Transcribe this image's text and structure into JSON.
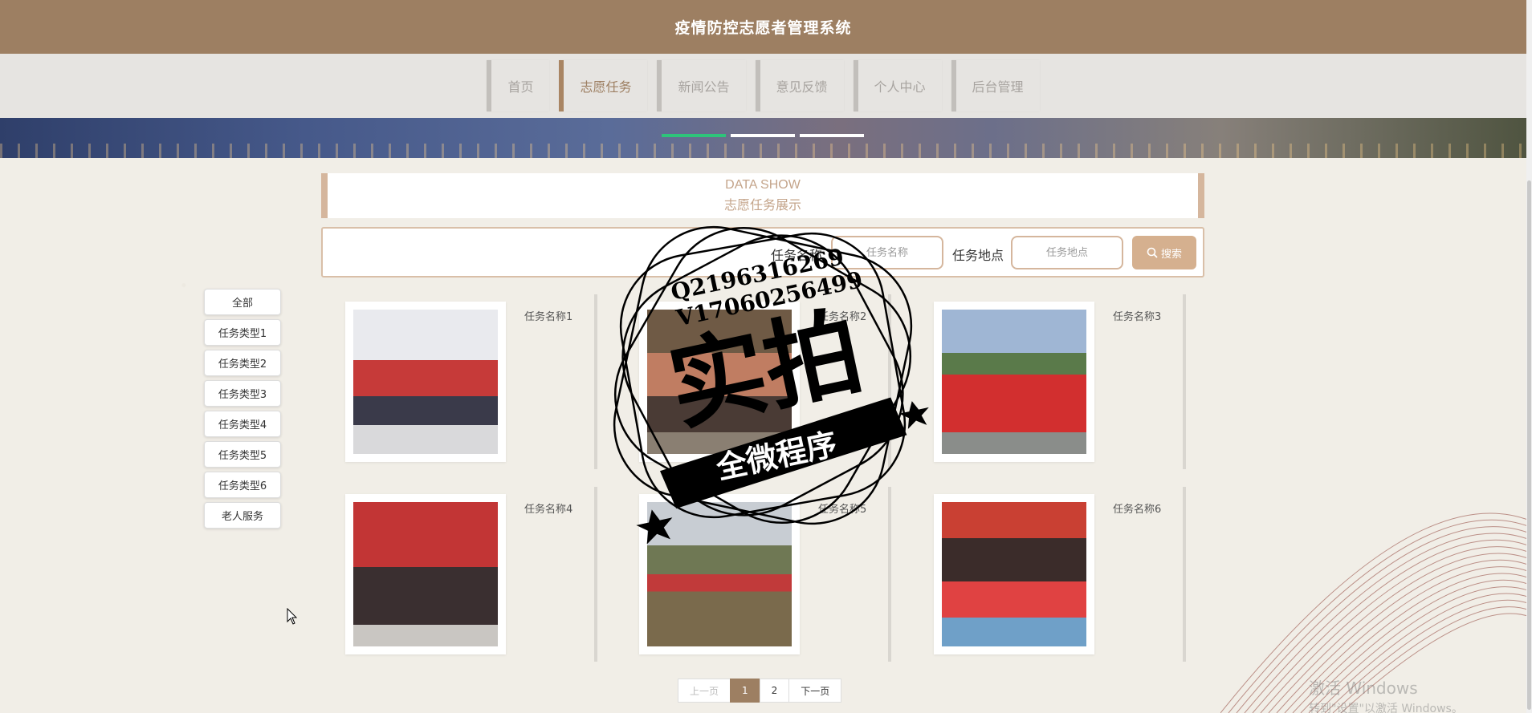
{
  "header": {
    "title": "疫情防控志愿者管理系统"
  },
  "nav": {
    "items": [
      {
        "label": "首页"
      },
      {
        "label": "志愿任务",
        "active": true
      },
      {
        "label": "新闻公告"
      },
      {
        "label": "意见反馈"
      },
      {
        "label": "个人中心"
      },
      {
        "label": "后台管理"
      }
    ]
  },
  "banner": {
    "slides": 3,
    "active_slide": 1
  },
  "section": {
    "title_en": "DATA SHOW",
    "title_cn": "志愿任务展示"
  },
  "search": {
    "name_label": "任务名称",
    "name_placeholder": "任务名称",
    "location_label": "任务地点",
    "location_placeholder": "任务地点",
    "button_label": "搜索"
  },
  "categories": [
    {
      "label": "全部"
    },
    {
      "label": "任务类型1"
    },
    {
      "label": "任务类型2"
    },
    {
      "label": "任务类型3"
    },
    {
      "label": "任务类型4"
    },
    {
      "label": "任务类型5"
    },
    {
      "label": "任务类型6"
    },
    {
      "label": "老人服务"
    }
  ],
  "tasks": [
    {
      "name": "任务名称1"
    },
    {
      "name": "任务名称2"
    },
    {
      "name": "任务名称3"
    },
    {
      "name": "任务名称4"
    },
    {
      "name": "任务名称5"
    },
    {
      "name": "任务名称6"
    }
  ],
  "pagination": {
    "prev": "上一页",
    "pages": [
      "1",
      "2"
    ],
    "current": "1",
    "next": "下一页"
  },
  "stamp": {
    "line1": "Q2196316269",
    "line2": "V17060256499",
    "big": "实拍",
    "ribbon": "全微程序"
  },
  "os_watermark": {
    "line1": "激活 Windows",
    "line2": "转到\"设置\"以激活 Windows。"
  }
}
